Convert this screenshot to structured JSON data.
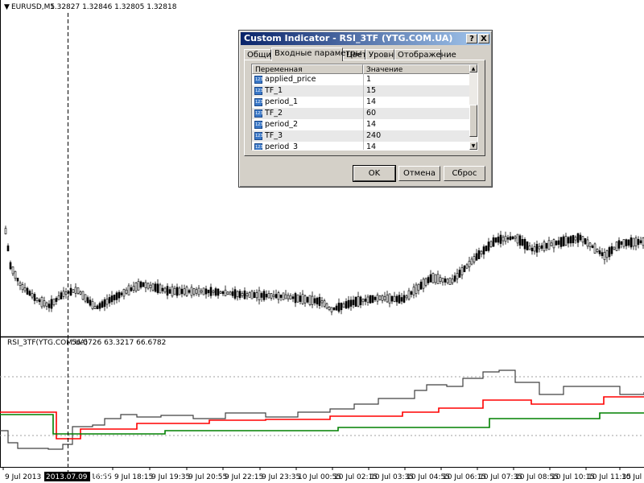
{
  "main_chart": {
    "symbol_label": "EURUSD,M5",
    "ohlc": "1.32827 1.32846 1.32805 1.32818"
  },
  "indicator_panel": {
    "label": "RSI_3TF(YTG.COM.UA)",
    "values": "56.5726 63.3217 66.6782"
  },
  "time_axis": {
    "labels": [
      "9 Jul 2013",
      "16:55",
      "9 Jul 18:15",
      "9 Jul 19:35",
      "9 Jul 20:55",
      "9 Jul 22:15",
      "9 Jul 23:35",
      "10 Jul 00:55",
      "10 Jul 02:15",
      "10 Jul 03:35",
      "10 Jul 04:55",
      "10 Jul 06:15",
      "10 Jul 07:35",
      "10 Jul 08:55",
      "10 Jul 10:15",
      "10 Jul 11:35",
      "10 Jul 12"
    ],
    "crosshair_label": "2013.07.09 16:30"
  },
  "dialog": {
    "title": "Custom Indicator - RSI_3TF (YTG.COM.UA)",
    "help_label": "?",
    "close_label": "X",
    "tabs": [
      "Общие",
      "Входные параметры",
      "Цвета",
      "Уровни",
      "Отображение"
    ],
    "active_tab": 1,
    "columns": {
      "variable": "Переменная",
      "value": "Значение"
    },
    "rows": [
      {
        "name": "applied_price",
        "value": "1"
      },
      {
        "name": "TF_1",
        "value": "15"
      },
      {
        "name": "period_1",
        "value": "14"
      },
      {
        "name": "TF_2",
        "value": "60"
      },
      {
        "name": "period_2",
        "value": "14"
      },
      {
        "name": "TF_3",
        "value": "240"
      },
      {
        "name": "period_3",
        "value": "14"
      }
    ],
    "param_icon_text": "123",
    "buttons": {
      "ok": "OK",
      "cancel": "Отмена",
      "reset": "Сброс"
    }
  },
  "colors": {
    "rsi_series_1": "#404040",
    "rsi_series_2": "#ff0000",
    "rsi_series_3": "#008000",
    "title_bar": "#0a246a"
  }
}
